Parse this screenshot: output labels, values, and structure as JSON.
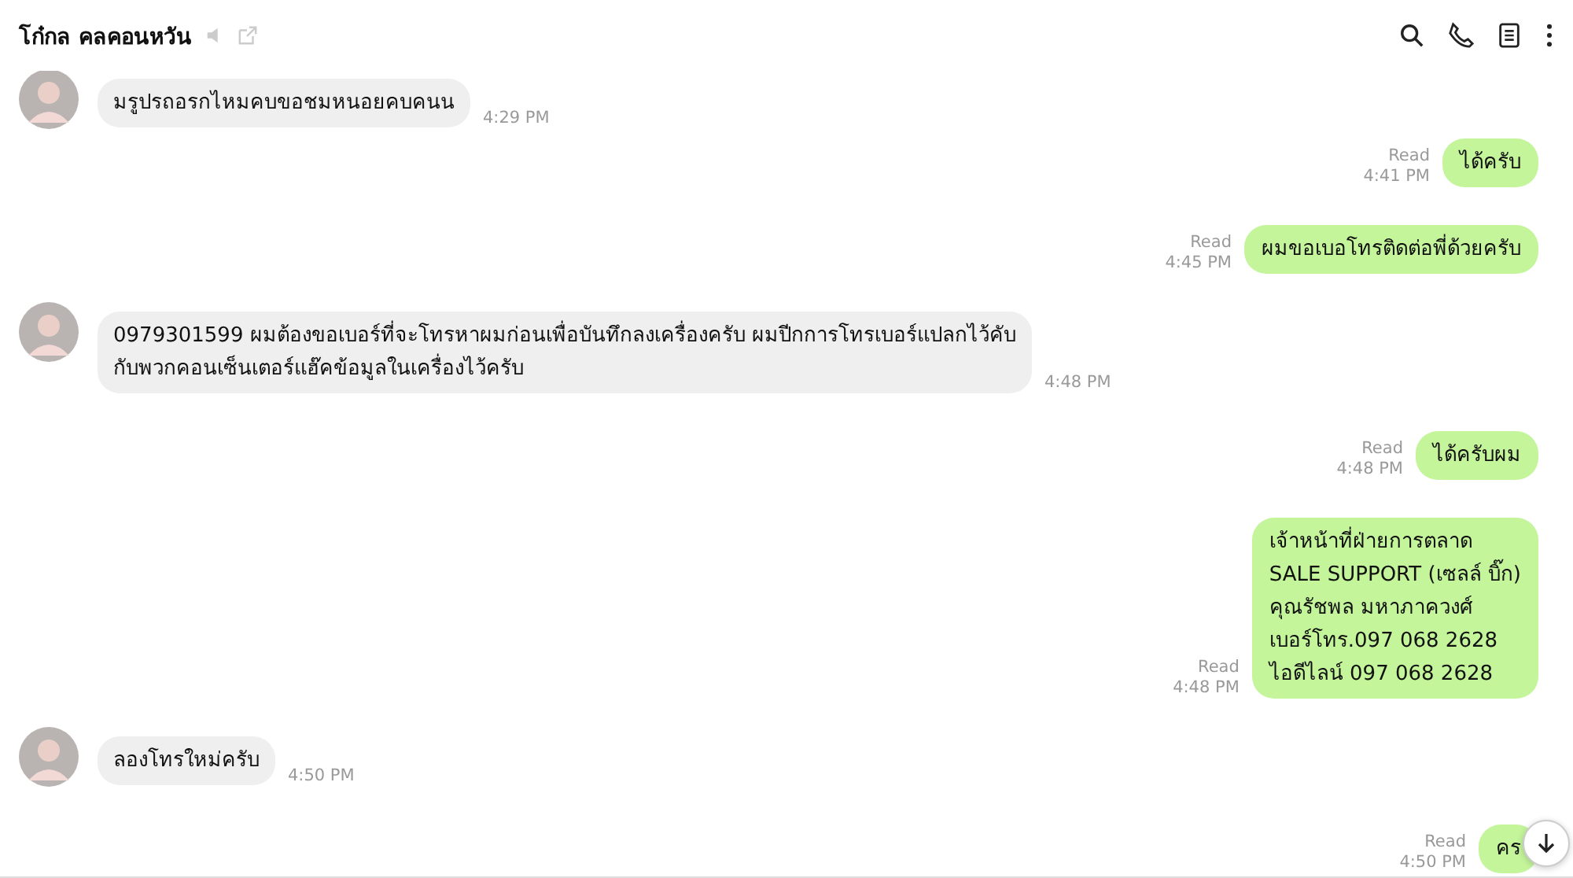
{
  "header": {
    "title": "โก๋กล คลคอนหวัน"
  },
  "messages": [
    {
      "kind": "incoming",
      "lines": [
        "มรูปรถอรกไหมคบขอชมหนอยคบคนน"
      ],
      "time": "4:29 PM"
    },
    {
      "kind": "outgoing",
      "lines": [
        "ได้ครับ"
      ],
      "status": "Read",
      "time": "4:41 PM"
    },
    {
      "kind": "outgoing",
      "lines": [
        "ผมขอเบอโทรติดต่อพี่ด้วยครับ"
      ],
      "status": "Read",
      "time": "4:45 PM"
    },
    {
      "kind": "incoming",
      "lines": [
        "0979301599 ผมต้องขอเบอร์ที่จะโทรหาผมก่อนเพื่อบันทึกลงเครื่องครับ ผมปีกการโทรเบอร์แปลกไว้คับ",
        "กับพวกคอนเซ็นเตอร์แฮ๊คข้อมูลในเครื่องไว้ครับ"
      ],
      "time": "4:48 PM"
    },
    {
      "kind": "outgoing",
      "lines": [
        "ได้ครับผม"
      ],
      "status": "Read",
      "time": "4:48 PM"
    },
    {
      "kind": "outgoing",
      "lines": [
        "เจ้าหน้าที่ฝ่ายการตลาด",
        "SALE  SUPPORT (เซลล์ บิ๊ก)",
        "คุณรัชพล  มหาภาควงศ์",
        "เบอร์โทร.097 068 2628",
        "ไอดีไลน์ 097 068 2628"
      ],
      "status": "Read",
      "time": "4:48 PM"
    },
    {
      "kind": "incoming",
      "lines": [
        "ลองโทรใหม่ครับ"
      ],
      "time": "4:50 PM"
    },
    {
      "kind": "outgoing",
      "lines": [
        "คร"
      ],
      "status": "Read",
      "time": "4:50 PM"
    }
  ]
}
